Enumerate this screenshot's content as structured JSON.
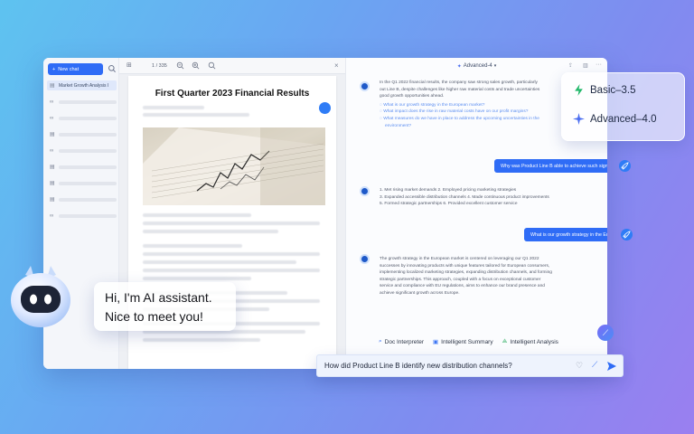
{
  "sidebar": {
    "new_chat_label": "New chat",
    "active_item_label": "Market Growth Analysis I",
    "item_count": 9
  },
  "doc": {
    "page_indicator": "1 / 335",
    "title": "First Quarter 2023 Financial Results"
  },
  "chat": {
    "model_selector": "Advanced-4",
    "msg1_intro": "In the Q1 2022 financial results, the company saw strong sales growth, particularly",
    "msg1_line2": "out Line B, despite challenges like higher raw material costs and trade uncertainties",
    "msg1_line3": "good growth opportunities ahead.",
    "msg1_links": [
      "What is our growth strategy in the European market?",
      "What impact does the rise in raw material costs have on our profit margins?",
      "What measures do we have in place to address the upcoming uncertainties in the",
      "environment?"
    ],
    "user_q1": "Why was Product Line B able to achieve such significant growth?",
    "msg2_items": [
      "1.  Met rising market demands   2.  Employed pricing marketing strategies",
      "3.  Expanded accessible distribution channels   4.  Made continuous product improvements",
      "5.  Formed strategic partnerships   6.  Provided excellent customer service"
    ],
    "user_q2": "What is our growth strategy in the European market?",
    "msg3_lines": [
      "The growth strategy in the European market is centered on leveraging our Q1 2022",
      "successes by innovating products with unique features tailored for European consumers,",
      "implementing localized marketing strategies, expanding distribution channels, and forming",
      "strategic partnerships. This approach, coupled with a focus on exceptional customer",
      "service and compliance with EU regulations, aims to enhance our brand presence and",
      "achieve significant growth across Europe."
    ],
    "tools": [
      "Doc Interpreter",
      "Intelligent Summary",
      "Intelligent Analysis"
    ]
  },
  "models": {
    "basic": "Basic–3.5",
    "advanced": "Advanced–4.0"
  },
  "input": {
    "value": "How did Product Line B identify new distribution channels?"
  },
  "greeting": {
    "line1": "Hi, I'm AI assistant.",
    "line2": "Nice to meet you!"
  },
  "colors": {
    "accent": "#2f6cf6",
    "basic_icon": "#22b86a",
    "advanced_icon": "#4a6df0"
  }
}
